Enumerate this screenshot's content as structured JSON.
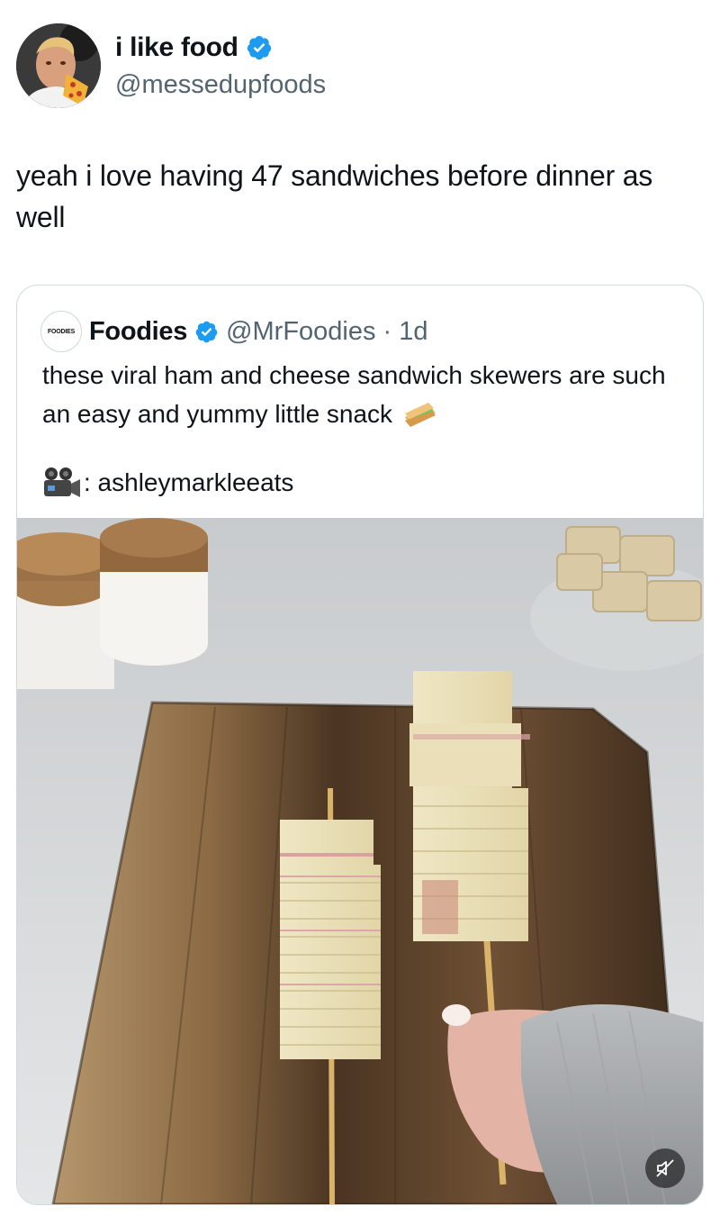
{
  "tweet": {
    "display_name": "i like food",
    "handle": "@messedupfoods",
    "verified": true,
    "text": "yeah i love having 47 sandwiches before dinner as well"
  },
  "quote": {
    "display_name": "Foodies",
    "avatar_text": "FOODIES",
    "verified": true,
    "handle": "@MrFoodies",
    "separator": "·",
    "time": "1d",
    "text": "these viral ham and cheese sandwich skewers are such an easy and yummy little snack",
    "text_emoji": "sandwich-emoji",
    "credit_icon": "movie-camera-emoji",
    "credit": ": ashleymarkleeats",
    "media": {
      "description_icon": "video-thumbnail",
      "muted": true
    }
  },
  "colors": {
    "verified_blue": "#1d9bf0",
    "secondary_text": "#536471",
    "border": "#cfd9de"
  }
}
